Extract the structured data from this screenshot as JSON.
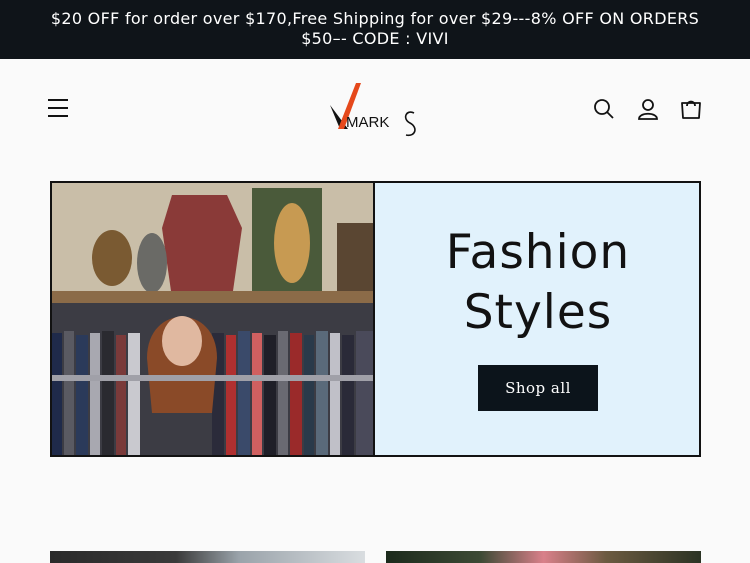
{
  "announcement": {
    "line1": "$20 OFF for order over $170,Free Shipping for over $29---8% OFF ON ORDERS",
    "line2": "$50–- CODE : VIVI"
  },
  "header": {
    "menu_icon": "hamburger-menu-icon",
    "logo_text_v": "V",
    "logo_text_mark": "MARK",
    "logo_text_s": "S",
    "search_icon": "search-icon",
    "account_icon": "account-icon",
    "cart_icon": "cart-icon"
  },
  "hero": {
    "title_line1": "Fashion",
    "title_line2": "Styles",
    "button_label": "Shop all"
  },
  "colors": {
    "announcement_bg": "#0f1419",
    "hero_bg": "#e1f2fc",
    "button_bg": "#0c141b",
    "logo_accent": "#e5481b"
  }
}
